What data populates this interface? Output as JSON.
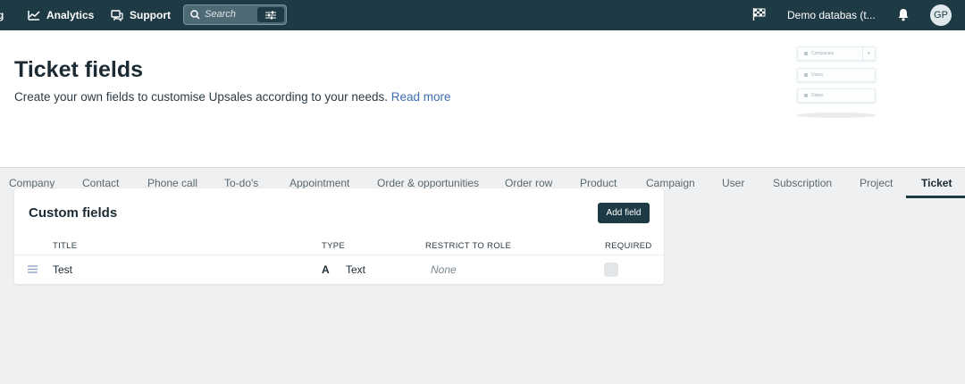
{
  "topbar": {
    "nav": [
      {
        "label": "g"
      },
      {
        "label": "Analytics"
      },
      {
        "label": "Support"
      }
    ],
    "search_placeholder": "Search",
    "workspace": "Demo databas (t...",
    "avatar_initials": "GP"
  },
  "header": {
    "title": "Ticket fields",
    "description": "Create your own fields to customise Upsales according to your needs.",
    "read_more": "Read more",
    "illustration": {
      "fields": [
        "Companies",
        "Users",
        "Dates"
      ]
    }
  },
  "tabs": [
    {
      "label": "Company"
    },
    {
      "label": "Contact"
    },
    {
      "label": "Phone call"
    },
    {
      "label": "To-do's"
    },
    {
      "label": "Appointment"
    },
    {
      "label": "Order & opportunities"
    },
    {
      "label": "Order row"
    },
    {
      "label": "Product"
    },
    {
      "label": "Campaign"
    },
    {
      "label": "User"
    },
    {
      "label": "Subscription"
    },
    {
      "label": "Project"
    },
    {
      "label": "Ticket"
    }
  ],
  "active_tab": "Ticket",
  "custom_fields": {
    "title": "Custom fields",
    "add_button": "Add field",
    "columns": [
      "TITLE",
      "TYPE",
      "RESTRICT TO ROLE",
      "REQUIRED"
    ],
    "rows": [
      {
        "title": "Test",
        "type_icon": "A",
        "type": "Text",
        "role": "None",
        "required": false
      }
    ]
  }
}
